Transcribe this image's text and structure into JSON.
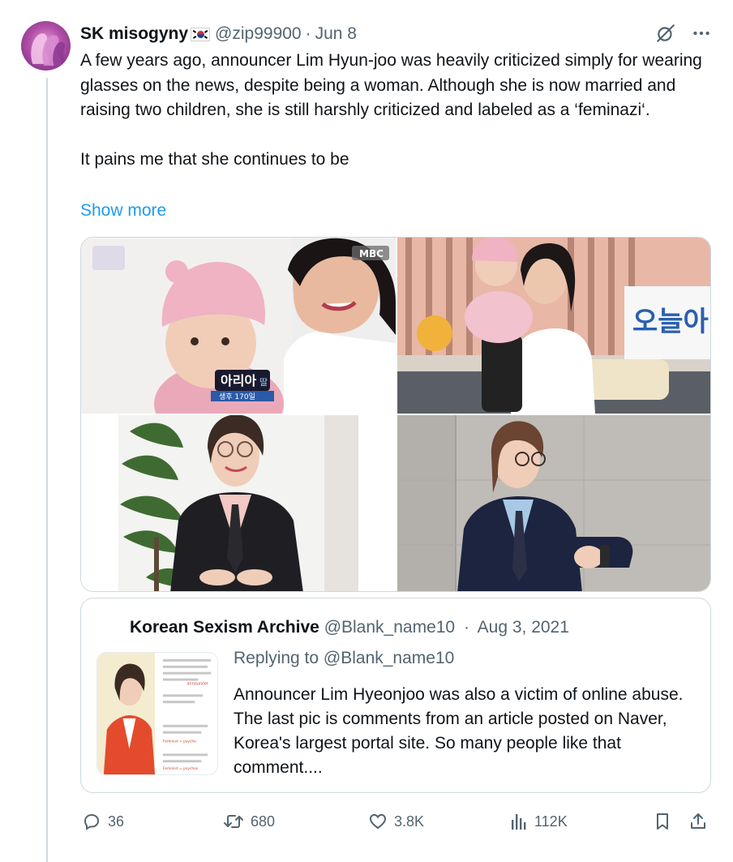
{
  "tweet": {
    "author": {
      "display_name": "SK misogyny",
      "flag_icon": "south-korea-flag-icon",
      "handle": "@zip99900",
      "separator": "·",
      "date": "Jun 8"
    },
    "text_paragraphs": [
      "A few years ago, announcer Lim Hyun-joo was heavily criticized simply for wearing glasses on the news, despite being a woman. Although she is now married and raising two children, she is still harshly criticized and labeled as a ‘feminazi‘.",
      "It pains me that she continues to be"
    ],
    "show_more_label": "Show more",
    "media_images": [
      {
        "overlay_logo": "MBC",
        "caption_name": "아리아",
        "caption_suffix": "딸",
        "caption_sub": "생후 170일"
      },
      {
        "overlay_sign": "오늘아"
      },
      {},
      {}
    ]
  },
  "quote": {
    "display_name": "Korean Sexism Archive",
    "handle": "@Blank_name10",
    "separator": "·",
    "date": "Aug 3, 2021",
    "replying_to": "Replying to @Blank_name10",
    "text": "Announcer Lim Hyeonjoo was also a victim of online abuse. The last pic is comments from an article posted on Naver, Korea's largest portal site. So many people like that comment....",
    "thumbnail_comment_fragments": [
      "announcer",
      "Feminist = psycho",
      "Feminist = psychos"
    ]
  },
  "actions": {
    "replies": "36",
    "reposts": "680",
    "likes": "3.8K",
    "views": "112K"
  },
  "colors": {
    "text": "#0f1419",
    "muted": "#536471",
    "link": "#1d9bf0",
    "border": "#cfd9de"
  }
}
